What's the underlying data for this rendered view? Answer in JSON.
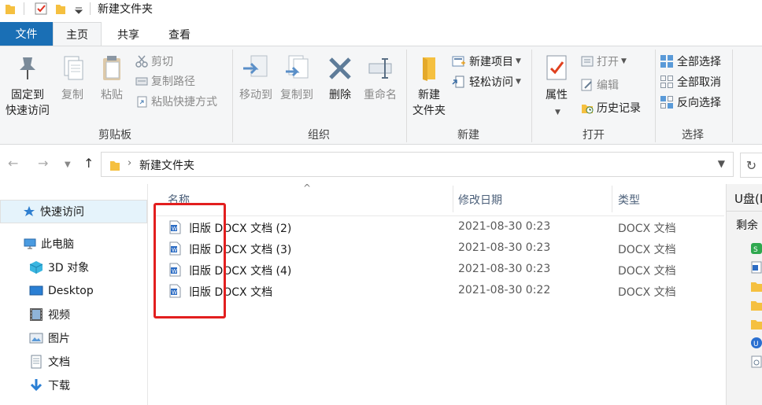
{
  "window": {
    "title": "新建文件夹"
  },
  "ribbon_tabs": {
    "file": "文件",
    "home": "主页",
    "share": "共享",
    "view": "查看"
  },
  "clipboard": {
    "pin_line1": "固定到",
    "pin_line2": "快速访问",
    "copy": "复制",
    "paste": "粘贴",
    "cut": "剪切",
    "copy_path": "复制路径",
    "paste_shortcut": "粘贴快捷方式",
    "group": "剪贴板"
  },
  "organize": {
    "move_to": "移动到",
    "copy_to": "复制到",
    "delete": "删除",
    "rename": "重命名",
    "group": "组织"
  },
  "new": {
    "new_folder_line1": "新建",
    "new_folder_line2": "文件夹",
    "new_item": "新建项目",
    "easy_access": "轻松访问",
    "group": "新建"
  },
  "open": {
    "properties": "属性",
    "open": "打开",
    "edit": "编辑",
    "history": "历史记录",
    "group": "打开"
  },
  "select": {
    "select_all": "全部选择",
    "select_none": "全部取消",
    "invert": "反向选择",
    "group": "选择"
  },
  "address": {
    "path": "新建文件夹"
  },
  "sidebar": {
    "items": [
      {
        "label": "快速访问",
        "icon": "star-icon"
      },
      {
        "label": "此电脑",
        "icon": "computer-icon"
      },
      {
        "label": "3D 对象",
        "icon": "3d-objects-icon"
      },
      {
        "label": "Desktop",
        "icon": "desktop-icon"
      },
      {
        "label": "视频",
        "icon": "video-icon"
      },
      {
        "label": "图片",
        "icon": "pictures-icon"
      },
      {
        "label": "文档",
        "icon": "documents-icon"
      },
      {
        "label": "下载",
        "icon": "download-icon"
      }
    ]
  },
  "columns": {
    "name": "名称",
    "modified": "修改日期",
    "type": "类型"
  },
  "files": [
    {
      "name": "旧版 DOCX 文档 (2)",
      "modified": "2021-08-30 0:23",
      "type": "DOCX 文档"
    },
    {
      "name": "旧版 DOCX 文档 (3)",
      "modified": "2021-08-30 0:23",
      "type": "DOCX 文档"
    },
    {
      "name": "旧版 DOCX 文档 (4)",
      "modified": "2021-08-30 0:23",
      "type": "DOCX 文档"
    },
    {
      "name": "旧版 DOCX 文档",
      "modified": "2021-08-30 0:22",
      "type": "DOCX 文档"
    }
  ],
  "right_pane": {
    "title": "U盘(I",
    "subtitle": "剩余"
  },
  "colors": {
    "accent": "#1a6fb5",
    "highlight_box": "#e21f1f",
    "selected_bg": "#e5f3fb",
    "folder": "#f5c040"
  }
}
